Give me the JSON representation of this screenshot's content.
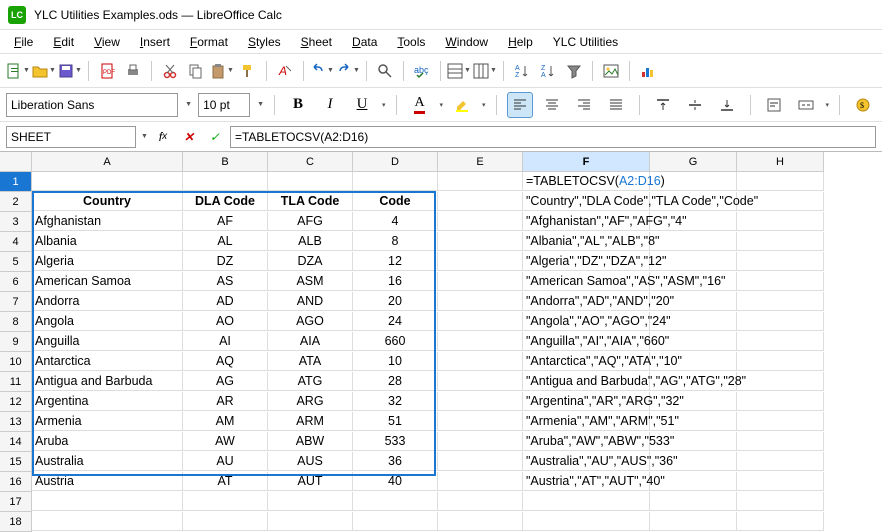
{
  "title": "YLC Utilities Examples.ods — LibreOffice Calc",
  "titleIcon": "LC",
  "menu": [
    "File",
    "Edit",
    "View",
    "Insert",
    "Format",
    "Styles",
    "Sheet",
    "Data",
    "Tools",
    "Window",
    "Help",
    "YLC Utilities"
  ],
  "font": {
    "name": "Liberation Sans",
    "size": "10 pt"
  },
  "nameBox": "SHEET",
  "formula": "=TABLETOCSV(A2:D16)",
  "columns": [
    "A",
    "B",
    "C",
    "D",
    "E",
    "F",
    "G",
    "H"
  ],
  "rowCount": 18,
  "headerRow": [
    "Country",
    "DLA Code",
    "TLA Code",
    "Code"
  ],
  "dataRows": [
    [
      "Afghanistan",
      "AF",
      "AFG",
      "4"
    ],
    [
      "Albania",
      "AL",
      "ALB",
      "8"
    ],
    [
      "Algeria",
      "DZ",
      "DZA",
      "12"
    ],
    [
      "American Samoa",
      "AS",
      "ASM",
      "16"
    ],
    [
      "Andorra",
      "AD",
      "AND",
      "20"
    ],
    [
      "Angola",
      "AO",
      "AGO",
      "24"
    ],
    [
      "Anguilla",
      "AI",
      "AIA",
      "660"
    ],
    [
      "Antarctica",
      "AQ",
      "ATA",
      "10"
    ],
    [
      "Antigua and Barbuda",
      "AG",
      "ATG",
      "28"
    ],
    [
      "Argentina",
      "AR",
      "ARG",
      "32"
    ],
    [
      "Armenia",
      "AM",
      "ARM",
      "51"
    ],
    [
      "Aruba",
      "AW",
      "ABW",
      "533"
    ],
    [
      "Australia",
      "AU",
      "AUS",
      "36"
    ],
    [
      "Austria",
      "AT",
      "AUT",
      "40"
    ]
  ],
  "f1_prefix": "=TABLETOCSV(",
  "f1_ref": "A2:D16",
  "f1_suffix": ")",
  "csvOutput": [
    "\"Country\",\"DLA Code\",\"TLA Code\",\"Code\"",
    "\"Afghanistan\",\"AF\",\"AFG\",\"4\"",
    "\"Albania\",\"AL\",\"ALB\",\"8\"",
    "\"Algeria\",\"DZ\",\"DZA\",\"12\"",
    "\"American Samoa\",\"AS\",\"ASM\",\"16\"",
    "\"Andorra\",\"AD\",\"AND\",\"20\"",
    "\"Angola\",\"AO\",\"AGO\",\"24\"",
    "\"Anguilla\",\"AI\",\"AIA\",\"660\"",
    "\"Antarctica\",\"AQ\",\"ATA\",\"10\"",
    "\"Antigua and Barbuda\",\"AG\",\"ATG\",\"28\"",
    "\"Argentina\",\"AR\",\"ARG\",\"32\"",
    "\"Armenia\",\"AM\",\"ARM\",\"51\"",
    "\"Aruba\",\"AW\",\"ABW\",\"533\"",
    "\"Australia\",\"AU\",\"AUS\",\"36\"",
    "\"Austria\",\"AT\",\"AUT\",\"40\""
  ]
}
